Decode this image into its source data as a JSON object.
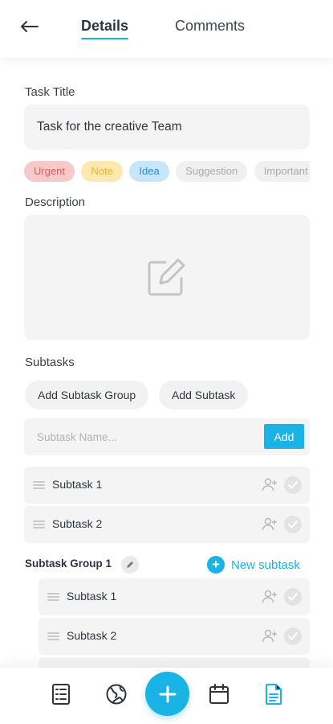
{
  "header": {
    "back_icon": "arrow-left-icon",
    "tabs": [
      {
        "label": "Details",
        "active": true
      },
      {
        "label": "Comments",
        "active": false
      }
    ]
  },
  "task_title": {
    "label": "Task Title",
    "value": "Task for the creative Team"
  },
  "tags": [
    {
      "label": "Urgent"
    },
    {
      "label": "Note"
    },
    {
      "label": "Idea"
    },
    {
      "label": "Suggestion"
    },
    {
      "label": "Important"
    }
  ],
  "description": {
    "label": "Description",
    "icon": "edit-icon"
  },
  "subtasks": {
    "label": "Subtasks",
    "add_group_label": "Add Subtask Group",
    "add_subtask_label": "Add Subtask",
    "input_placeholder": "Subtask Name...",
    "add_button_label": "Add",
    "items": [
      {
        "name": "Subtask 1"
      },
      {
        "name": "Subtask 2"
      }
    ]
  },
  "group": {
    "title": "Subtask Group 1",
    "new_subtask_label": "New subtask",
    "items": [
      {
        "name": "Subtask 1"
      },
      {
        "name": "Subtask 2"
      }
    ]
  },
  "bottom_nav": {
    "items": [
      "checklist-icon",
      "globe-icon",
      "add-icon",
      "calendar-icon",
      "document-icon"
    ],
    "active": "document-icon"
  },
  "colors": {
    "accent": "#19b3e6",
    "field_bg": "#f4f4f4",
    "text": "#2f3640"
  }
}
